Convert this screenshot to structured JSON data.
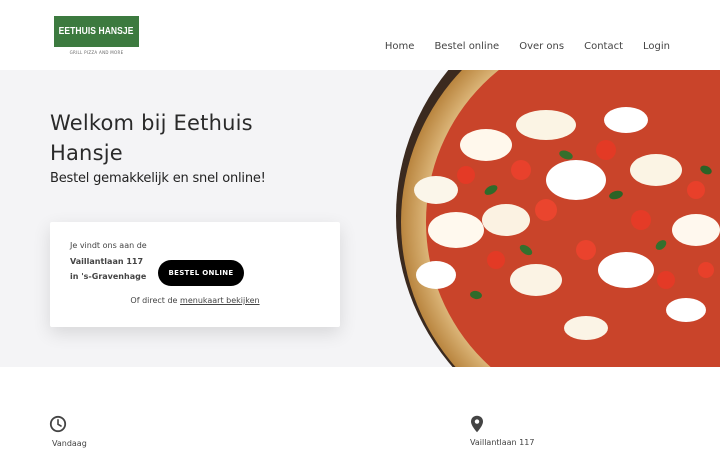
{
  "header": {
    "logo_title": "EETHUIS HANSJE",
    "logo_subtitle": "GRILL PIZZA AND MORE",
    "brand_color": "#3c7a3f",
    "nav": [
      "Home",
      "Bestel online",
      "Over ons",
      "Contact",
      "Login"
    ]
  },
  "hero": {
    "title": "Welkom bij Eethuis Hansje",
    "subtitle": "Bestel gemakkelijk en snel online!",
    "image_icon": "pizza-image"
  },
  "card": {
    "intro": "Je vindt ons aan de",
    "street": "Vaillantlaan 117",
    "city": "in 's-Gravenhage",
    "order_button": "BESTEL ONLINE",
    "bottom_prefix": "Of direct de",
    "menu_link": "menukaart bekijken"
  },
  "info": {
    "clock_icon": "clock-icon",
    "today": "Vandaag",
    "pin_icon": "map-pin-icon",
    "address": "Vaillantlaan 117"
  }
}
